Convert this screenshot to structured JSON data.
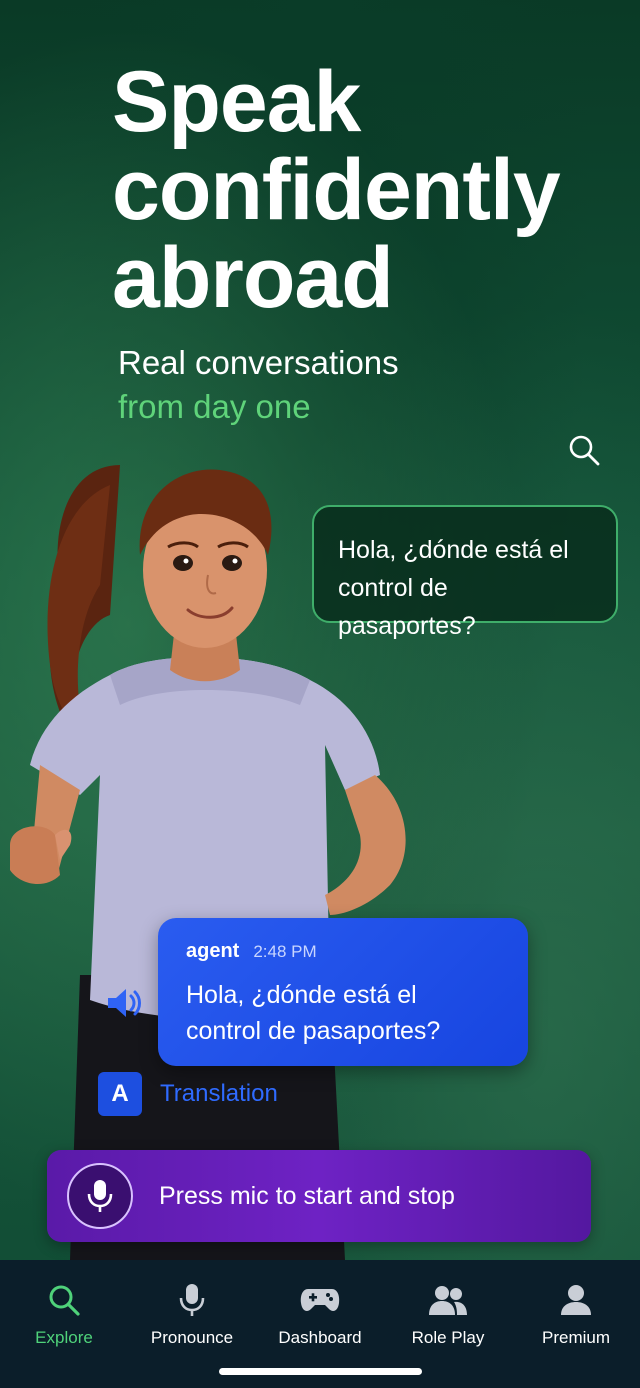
{
  "hero": {
    "headline_lines": [
      "Speak",
      "confidently",
      "abroad"
    ],
    "subtitle_line1": "Real conversations",
    "subtitle_line2": "from day one"
  },
  "speech_bubble": {
    "text_line1": "Hola, ¿dónde está el",
    "text_line2": "control de pasaportes?"
  },
  "message": {
    "author": "agent",
    "time": "2:48 PM",
    "text_line1": "Hola, ¿dónde está el",
    "text_line2": "control de pasaportes?"
  },
  "translation": {
    "icon_letter": "A",
    "label": "Translation"
  },
  "mic_bar": {
    "label": "Press mic to start and stop"
  },
  "tabs": [
    {
      "label": "Explore",
      "icon": "search-icon",
      "active": true
    },
    {
      "label": "Pronounce",
      "icon": "microphone-icon",
      "active": false
    },
    {
      "label": "Dashboard",
      "icon": "gamepad-icon",
      "active": false
    },
    {
      "label": "Role Play",
      "icon": "people-icon",
      "active": false
    },
    {
      "label": "Premium",
      "icon": "person-icon",
      "active": false
    }
  ],
  "colors": {
    "accent_green": "#4fd27a",
    "message_blue": "#1d4fe0",
    "mic_purple": "#6e22c4",
    "tabbar_bg": "#0b1e2a"
  }
}
